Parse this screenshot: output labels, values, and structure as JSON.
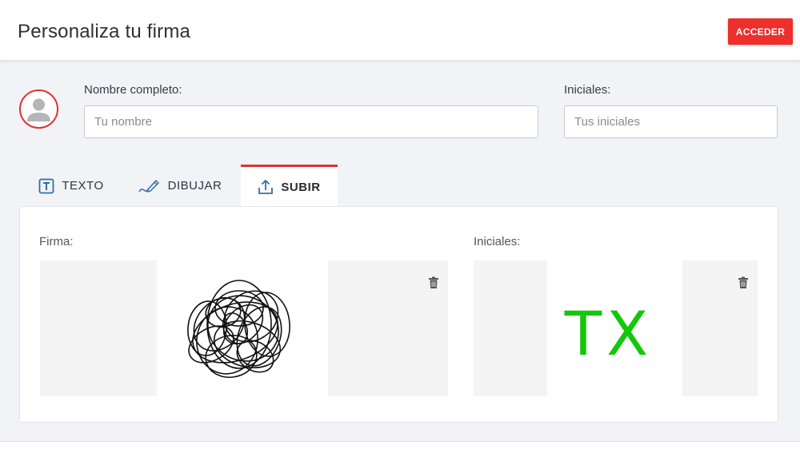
{
  "header": {
    "title": "Personaliza tu firma",
    "login_label": "ACCEDER"
  },
  "form": {
    "fullname_label": "Nombre completo:",
    "fullname_value": "",
    "fullname_placeholder": "Tu nombre",
    "initials_label": "Iniciales:",
    "initials_value": "",
    "initials_placeholder": "Tus iniciales"
  },
  "tabs": [
    {
      "label": "TEXTO",
      "icon": "text-box-icon",
      "active": false
    },
    {
      "label": "DIBUJAR",
      "icon": "pen-drawing-icon",
      "active": false
    },
    {
      "label": "SUBIR",
      "icon": "upload-icon",
      "active": true
    }
  ],
  "upload_panel": {
    "signature_label": "Firma:",
    "initials_label": "Iniciales:",
    "initials_preview": "TX",
    "initials_color": "#13c70a"
  },
  "colors": {
    "accent": "#e0322f",
    "button": "#ee2f2c",
    "background": "#f2f3f7"
  }
}
